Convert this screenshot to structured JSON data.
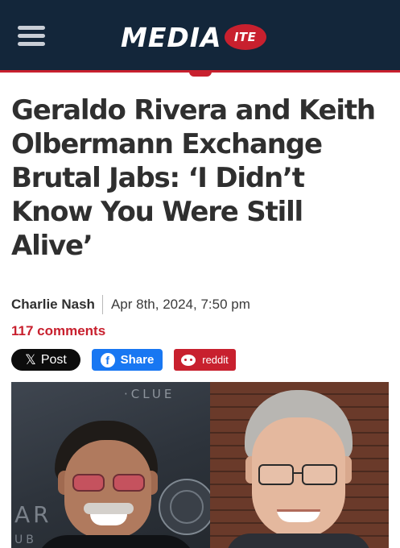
{
  "header": {
    "menu_icon": "hamburger-menu-icon",
    "logo_main": "MEDIA",
    "logo_badge": "ITE",
    "colors": {
      "header_bg": "#13263a",
      "accent": "#c8202e"
    }
  },
  "article": {
    "headline": "Geraldo Rivera and Keith Olbermann Exchange Brutal Jabs: ‘I Didn’t Know You Were Still Alive’",
    "author": "Charlie Nash",
    "date": "Apr 8th, 2024, 7:50 pm",
    "comments": "117 comments"
  },
  "share": {
    "x_glyph": "𝕏",
    "x_label": "Post",
    "facebook_glyph": "f",
    "facebook_label": "Share",
    "reddit_label": "reddit",
    "icons": [
      "x-logo-icon",
      "facebook-icon",
      "reddit-icon"
    ]
  },
  "photo": {
    "background_text_top": "·CLUE",
    "background_text_mid": "AR",
    "background_text_bottom": "UB"
  }
}
